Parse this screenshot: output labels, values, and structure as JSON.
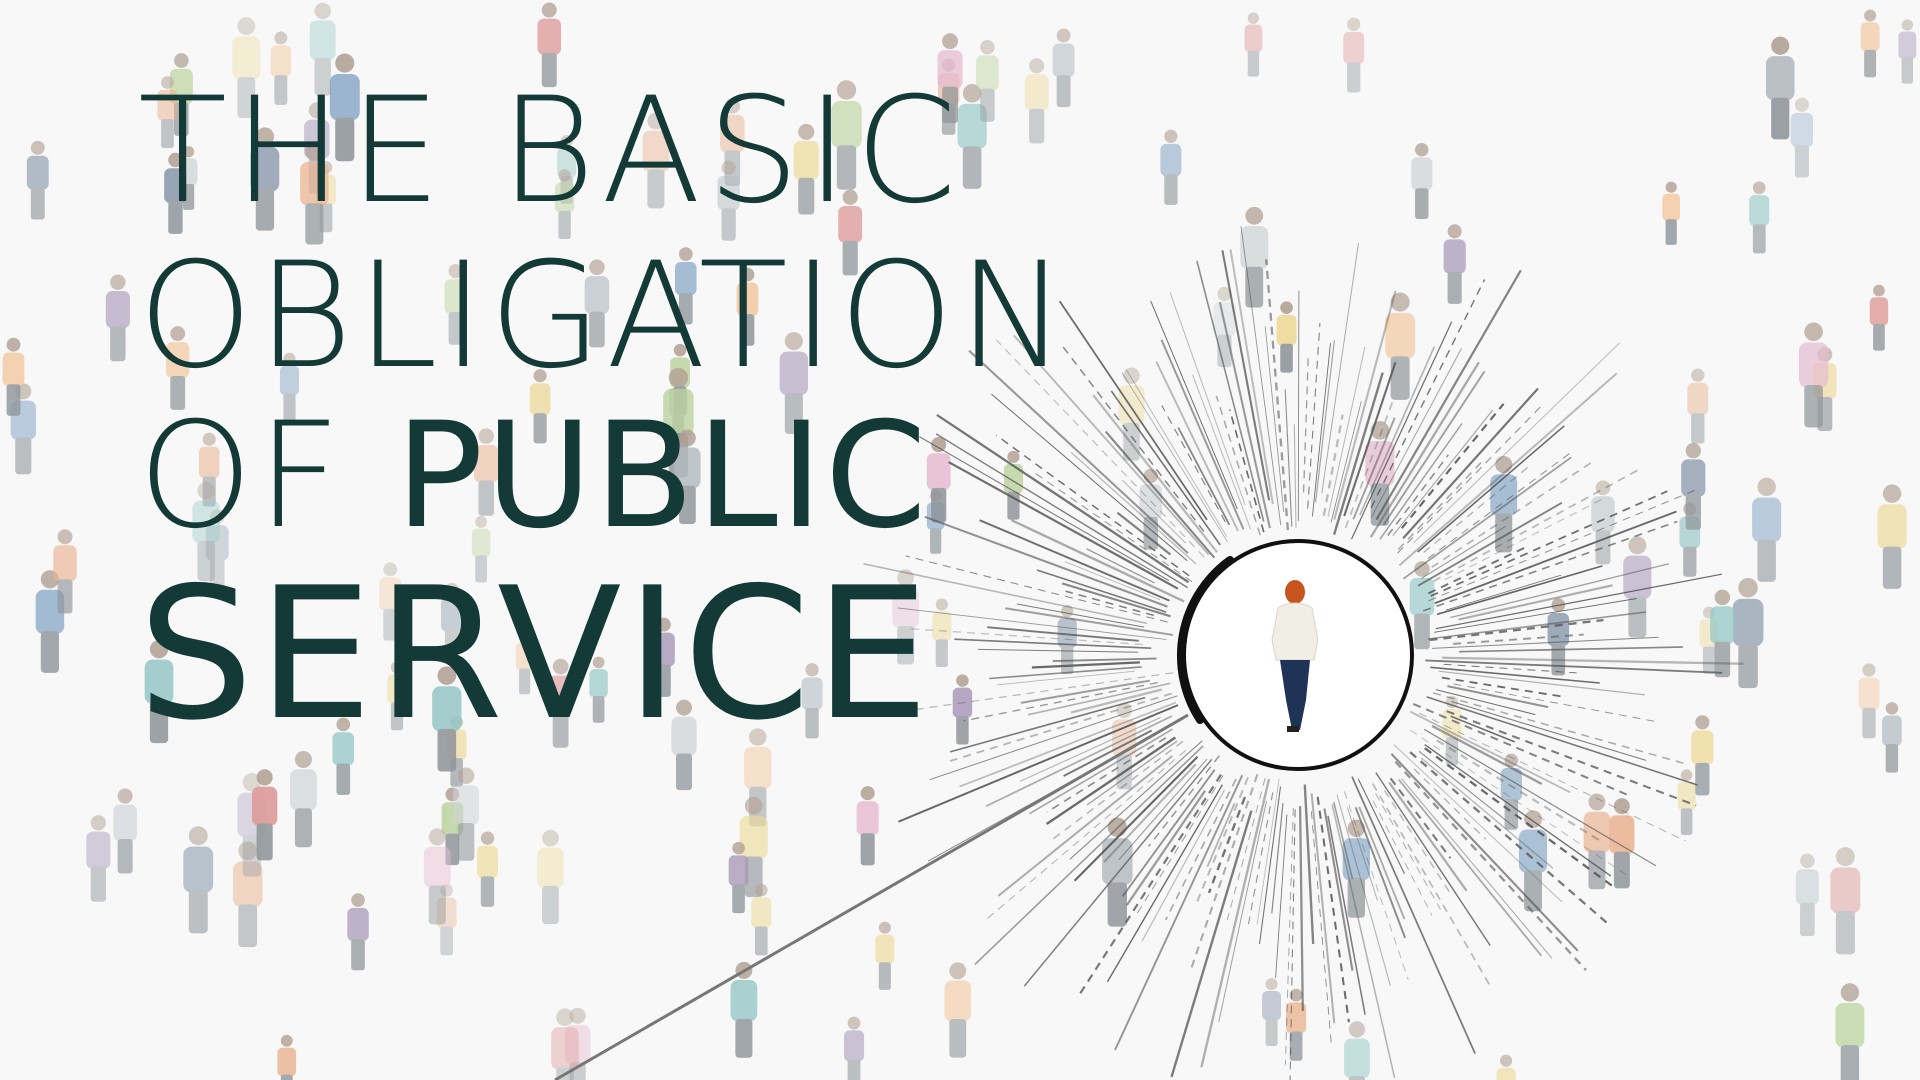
{
  "title": {
    "line1": "THE BASIC",
    "line2": "OBLIGATION",
    "line3_thin": "OF ",
    "line3_bold": "PUBLIC",
    "line4": "SERVICE"
  },
  "colors": {
    "title_text": "#133a36",
    "background": "#f7f8f7",
    "ring": "#111111",
    "rays": "#555555",
    "highlight_figure_hair": "#c8541e"
  }
}
